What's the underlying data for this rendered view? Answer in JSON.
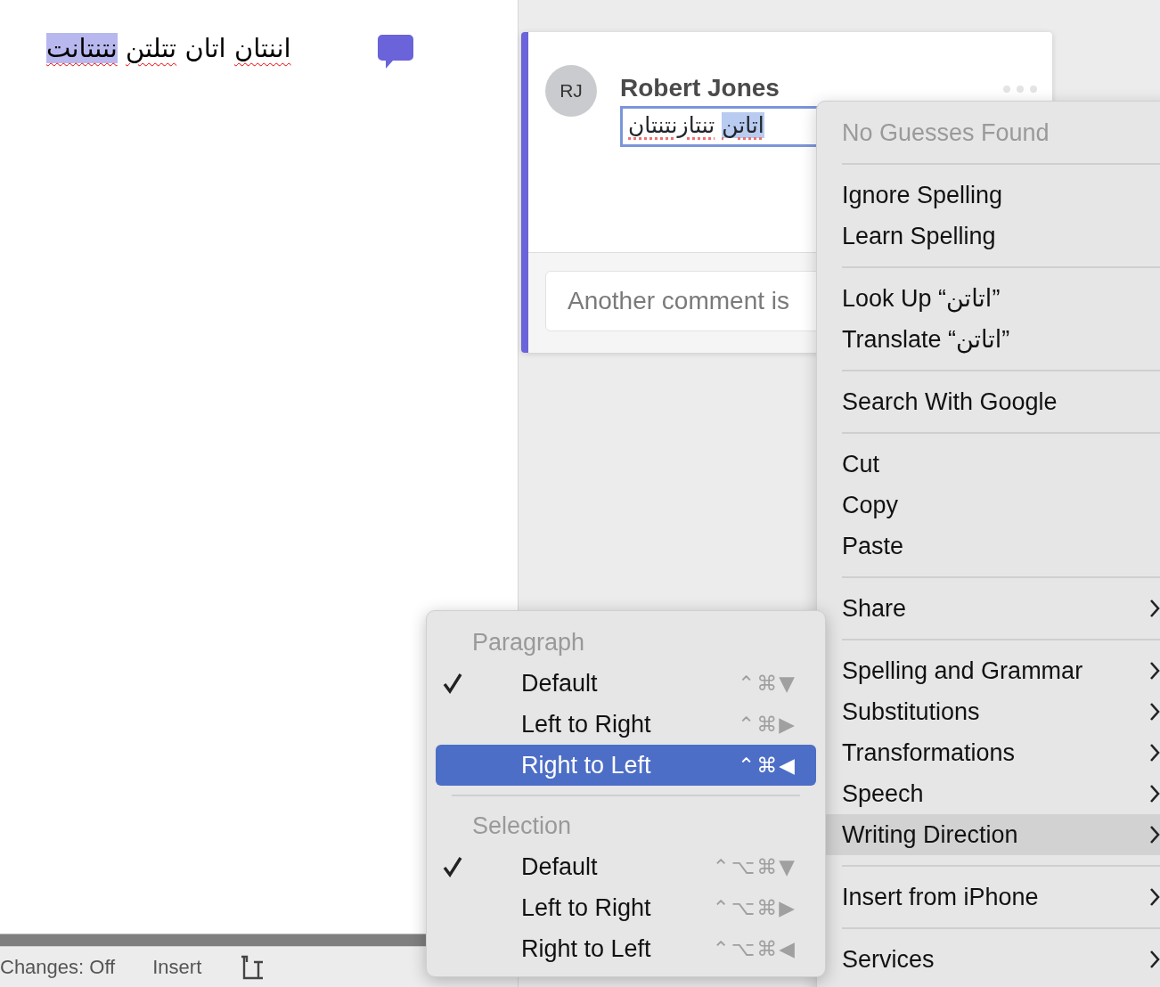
{
  "document": {
    "words": [
      {
        "text": "اننتان",
        "misspelled": true,
        "selected": false
      },
      {
        "text": "اتان",
        "misspelled": false,
        "selected": false
      },
      {
        "text": "تتلتن",
        "misspelled": true,
        "selected": false
      },
      {
        "text": "نتنتانت",
        "misspelled": true,
        "selected": true
      }
    ]
  },
  "comment": {
    "avatar": "RJ",
    "author": "Robert Jones",
    "edit_words": [
      {
        "text": "اتاتن",
        "selected": true
      },
      {
        "text": "تنتازنتنتان",
        "selected": false
      }
    ],
    "reply_placeholder": "Another comment is"
  },
  "status_bar": {
    "changes": "Changes: Off",
    "mode": "Insert"
  },
  "context_menu": [
    {
      "kind": "item",
      "label": "No Guesses Found",
      "disabled": true,
      "selected": false
    },
    {
      "kind": "separator"
    },
    {
      "kind": "item",
      "label": "Ignore Spelling",
      "disabled": false,
      "selected": false
    },
    {
      "kind": "item",
      "label": "Learn Spelling",
      "disabled": false,
      "selected": false
    },
    {
      "kind": "separator"
    },
    {
      "kind": "item",
      "label": "Look Up “اتاتن”",
      "disabled": false,
      "selected": false
    },
    {
      "kind": "item",
      "label": "Translate “اتاتن”",
      "disabled": false,
      "selected": false
    },
    {
      "kind": "separator"
    },
    {
      "kind": "item",
      "label": "Search With Google",
      "disabled": false,
      "selected": false
    },
    {
      "kind": "separator"
    },
    {
      "kind": "item",
      "label": "Cut",
      "disabled": false,
      "selected": false
    },
    {
      "kind": "item",
      "label": "Copy",
      "disabled": false,
      "selected": false
    },
    {
      "kind": "item",
      "label": "Paste",
      "disabled": false,
      "selected": false
    },
    {
      "kind": "separator"
    },
    {
      "kind": "submenu",
      "label": "Share",
      "disabled": false,
      "selected": false
    },
    {
      "kind": "separator"
    },
    {
      "kind": "submenu",
      "label": "Spelling and Grammar",
      "disabled": false,
      "selected": false
    },
    {
      "kind": "submenu",
      "label": "Substitutions",
      "disabled": false,
      "selected": false
    },
    {
      "kind": "submenu",
      "label": "Transformations",
      "disabled": false,
      "selected": false
    },
    {
      "kind": "submenu",
      "label": "Speech",
      "disabled": false,
      "selected": false
    },
    {
      "kind": "submenu",
      "label": "Writing Direction",
      "disabled": false,
      "selected": true
    },
    {
      "kind": "separator"
    },
    {
      "kind": "submenu",
      "label": "Insert from iPhone",
      "disabled": false,
      "selected": false
    },
    {
      "kind": "separator"
    },
    {
      "kind": "submenu",
      "label": "Services",
      "disabled": false,
      "selected": false
    }
  ],
  "writing_direction_menu": [
    {
      "kind": "header",
      "label": "Paragraph"
    },
    {
      "kind": "item",
      "label": "Default",
      "shortcut": "⌃⌘▼",
      "checked": true,
      "selected": false
    },
    {
      "kind": "item",
      "label": "Left to Right",
      "shortcut": "⌃⌘▶",
      "checked": false,
      "selected": false
    },
    {
      "kind": "item",
      "label": "Right to Left",
      "shortcut": "⌃⌘◀",
      "checked": false,
      "selected": true
    },
    {
      "kind": "separator"
    },
    {
      "kind": "header",
      "label": "Selection"
    },
    {
      "kind": "item",
      "label": "Default",
      "shortcut": "⌃⌥⌘▼",
      "checked": true,
      "selected": false
    },
    {
      "kind": "item",
      "label": "Left to Right",
      "shortcut": "⌃⌥⌘▶",
      "checked": false,
      "selected": false
    },
    {
      "kind": "item",
      "label": "Right to Left",
      "shortcut": "⌃⌥⌘◀",
      "checked": false,
      "selected": false
    }
  ]
}
